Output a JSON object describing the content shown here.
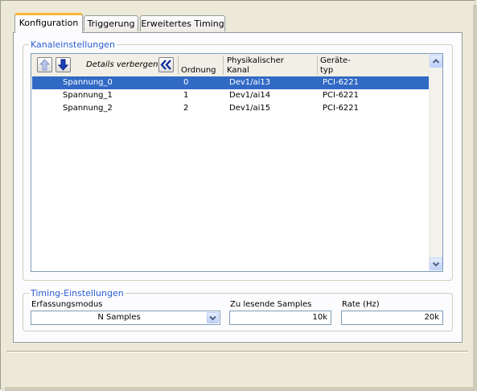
{
  "tabs": [
    {
      "label": "Konfiguration",
      "active": true
    },
    {
      "label": "Triggerung",
      "active": false
    },
    {
      "label": "Erweitertes Timing",
      "active": false
    }
  ],
  "channel_settings": {
    "title": "Kanaleinstellungen",
    "details_toggle_label": "Details verbergen",
    "columns": {
      "order": "Ordnung",
      "physical_channel": "Physikalischer\nKanal",
      "device_type": "Geräte-\ntyp"
    },
    "rows": [
      {
        "name": "Spannung_0",
        "order": "0",
        "physical_channel": "Dev1/ai13",
        "device_type": "PCI-6221",
        "selected": true
      },
      {
        "name": "Spannung_1",
        "order": "1",
        "physical_channel": "Dev1/ai14",
        "device_type": "PCI-6221",
        "selected": false
      },
      {
        "name": "Spannung_2",
        "order": "2",
        "physical_channel": "Dev1/ai15",
        "device_type": "PCI-6221",
        "selected": false
      }
    ],
    "icons": {
      "move_up": "arrow-up-icon",
      "move_down": "arrow-down-icon",
      "collapse_details": "double-chevron-left-icon"
    }
  },
  "timing_settings": {
    "title": "Timing-Einstellungen",
    "acquisition_mode": {
      "label": "Erfassungsmodus",
      "value": "N Samples"
    },
    "samples_to_read": {
      "label": "Zu lesende Samples",
      "value": "10k"
    },
    "rate": {
      "label": "Rate (Hz)",
      "value": "20k"
    }
  },
  "colors": {
    "selection": "#316AC5",
    "group_title": "#2A5DD0",
    "active_tab_accent": "#F8B439",
    "window_background": "#ECE9D8"
  }
}
